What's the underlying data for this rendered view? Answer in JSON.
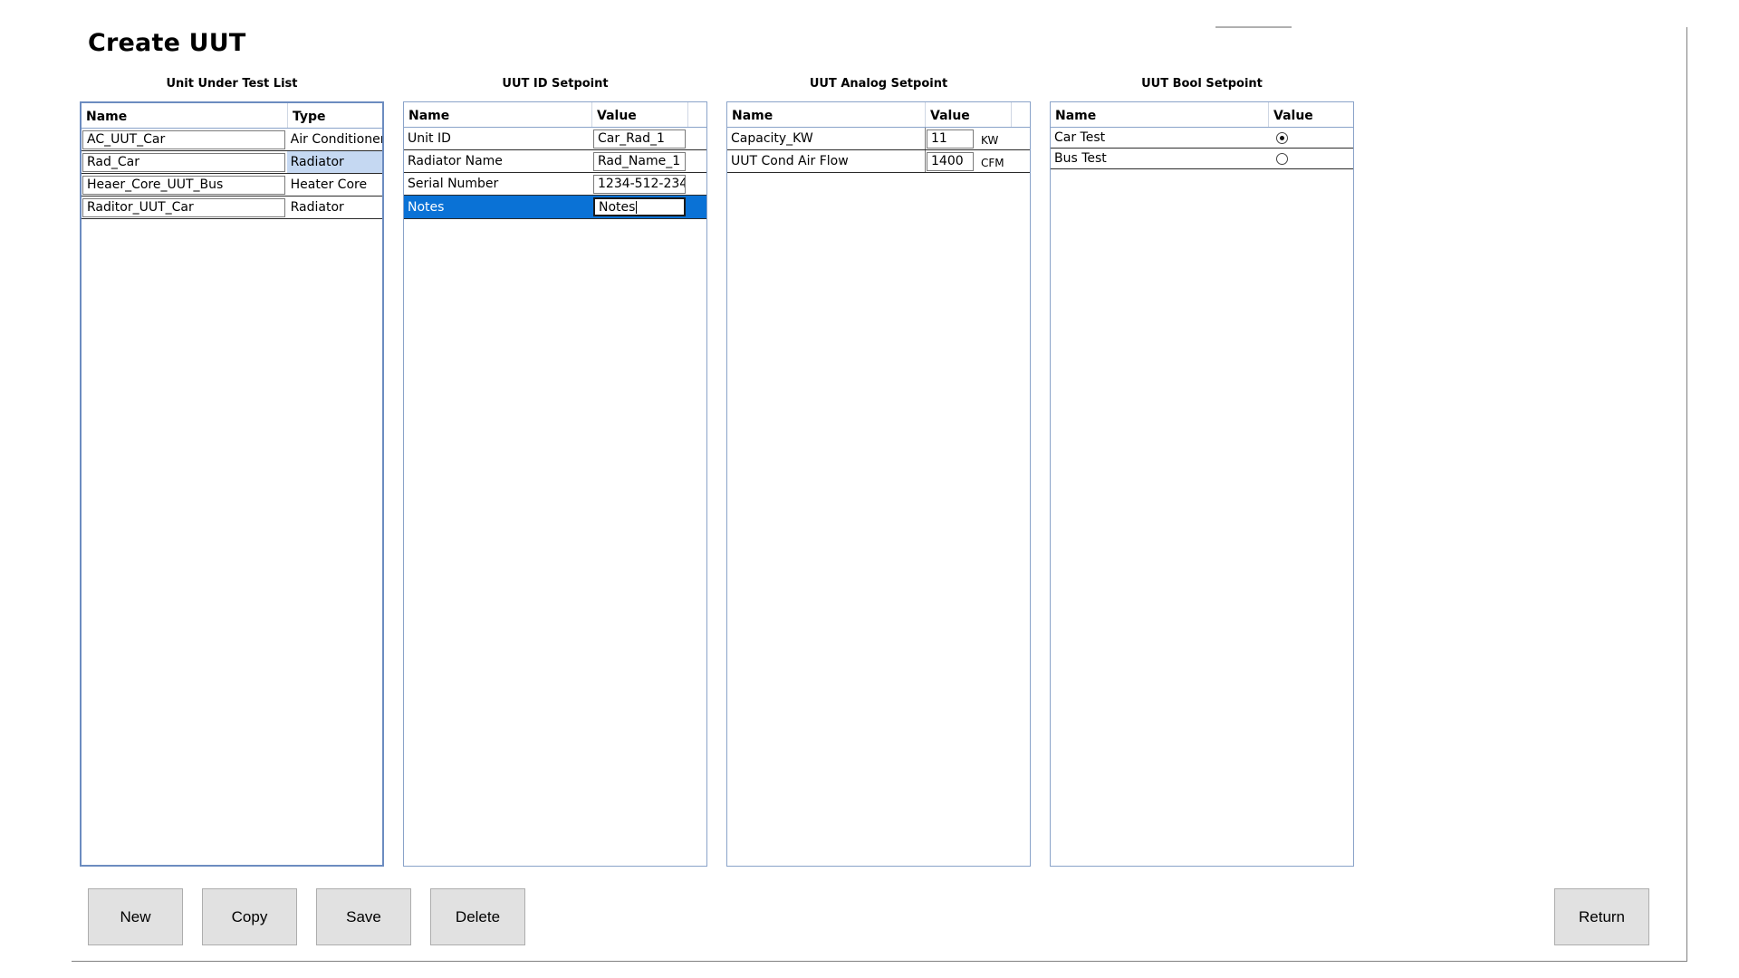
{
  "page": {
    "title": "Create UUT"
  },
  "unit_list": {
    "title": "Unit Under Test List",
    "columns": [
      "Name",
      "Type"
    ],
    "rows": [
      {
        "name": "AC_UUT_Car",
        "type": "Air Conditioner"
      },
      {
        "name": "Rad_Car",
        "type": "Radiator"
      },
      {
        "name": "Heaer_Core_UUT_Bus",
        "type": "Heater Core"
      },
      {
        "name": "Raditor_UUT_Car",
        "type": "Radiator"
      }
    ],
    "selected_row": 1
  },
  "id_setpoint": {
    "title": "UUT ID Setpoint",
    "columns": [
      "Name",
      "Value"
    ],
    "rows": [
      {
        "name": "Unit ID",
        "value": "Car_Rad_1"
      },
      {
        "name": "Radiator Name",
        "value": "Rad_Name_1"
      },
      {
        "name": "Serial Number",
        "value": "1234-512-234"
      },
      {
        "name": "Notes",
        "value": "Notes"
      }
    ],
    "selected_row": 3
  },
  "analog_setpoint": {
    "title": "UUT Analog Setpoint",
    "columns": [
      "Name",
      "Value"
    ],
    "rows": [
      {
        "name": "Capacity_KW",
        "value": "11",
        "unit": "KW"
      },
      {
        "name": "UUT Cond Air Flow",
        "value": "1400",
        "unit": "CFM"
      }
    ]
  },
  "bool_setpoint": {
    "title": "UUT Bool Setpoint",
    "columns": [
      "Name",
      "Value"
    ],
    "rows": [
      {
        "name": "Car Test",
        "checked": true
      },
      {
        "name": "Bus Test",
        "checked": false
      }
    ]
  },
  "buttons": {
    "new": "New",
    "copy": "Copy",
    "save": "Save",
    "delete": "Delete",
    "return": "Return"
  },
  "icons": {
    "radio_on": "radio-selected-icon",
    "radio_off": "radio-unselected-icon"
  },
  "colors": {
    "selection": "#0a72d6",
    "cell_highlight": "#c5d8f2",
    "grid_border": "#8aa3c9"
  }
}
